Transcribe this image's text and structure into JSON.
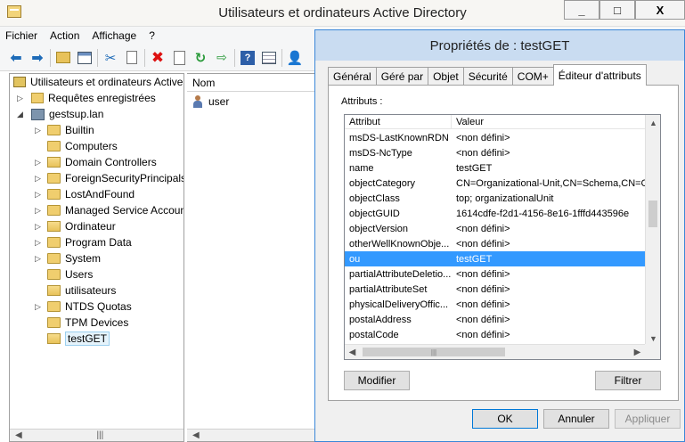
{
  "window": {
    "title": "Utilisateurs et ordinateurs Active Directory",
    "min": "_",
    "max": "□",
    "close": "X"
  },
  "menu": [
    "Fichier",
    "Action",
    "Affichage",
    "?"
  ],
  "tree": {
    "root": "Utilisateurs et ordinateurs Active",
    "saved_queries": "Requêtes enregistrées",
    "domain": "gestsup.lan",
    "items": [
      "Builtin",
      "Computers",
      "Domain Controllers",
      "ForeignSecurityPrincipals",
      "LostAndFound",
      "Managed Service Accounts",
      "Ordinateur",
      "Program Data",
      "System",
      "Users",
      "utilisateurs",
      "NTDS Quotas",
      "TPM Devices",
      "testGET"
    ]
  },
  "list": {
    "column": "Nom",
    "rows": [
      "user"
    ]
  },
  "dialog": {
    "title": "Propriétés de : testGET",
    "tabs": [
      "Général",
      "Géré par",
      "Objet",
      "Sécurité",
      "COM+",
      "Éditeur d'attributs"
    ],
    "attributes_label": "Attributs :",
    "col_attr": "Attribut",
    "col_value": "Valeur",
    "rows": [
      {
        "a": "msDS-LastKnownRDN",
        "v": "<non défini>"
      },
      {
        "a": "msDS-NcType",
        "v": "<non défini>"
      },
      {
        "a": "name",
        "v": "testGET"
      },
      {
        "a": "objectCategory",
        "v": "CN=Organizational-Unit,CN=Schema,CN=Co"
      },
      {
        "a": "objectClass",
        "v": "top; organizationalUnit"
      },
      {
        "a": "objectGUID",
        "v": "1614cdfe-f2d1-4156-8e16-1fffd443596e"
      },
      {
        "a": "objectVersion",
        "v": "<non défini>"
      },
      {
        "a": "otherWellKnownObje...",
        "v": "<non défini>"
      },
      {
        "a": "ou",
        "v": "testGET"
      },
      {
        "a": "partialAttributeDeletio...",
        "v": "<non défini>"
      },
      {
        "a": "partialAttributeSet",
        "v": "<non défini>"
      },
      {
        "a": "physicalDeliveryOffic...",
        "v": "<non défini>"
      },
      {
        "a": "postalAddress",
        "v": "<non défini>"
      },
      {
        "a": "postalCode",
        "v": "<non défini>"
      }
    ],
    "selected_row": "ou",
    "modify": "Modifier",
    "filter": "Filtrer",
    "ok": "OK",
    "cancel": "Annuler",
    "apply": "Appliquer"
  }
}
